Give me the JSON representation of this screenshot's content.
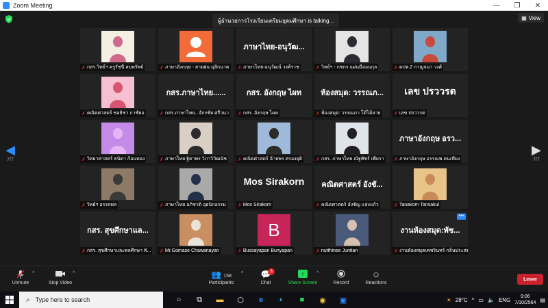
{
  "window": {
    "title": "Zoom Meeting",
    "controls": [
      "—",
      "❐",
      "✕"
    ]
  },
  "meeting": {
    "talking_text": "ผู้อำนวยการโรงเรียนเตรียมอุดมศึกษา is talking...",
    "view_label": "View",
    "page_indicator_left": "7/7",
    "page_indicator_right": "7/7"
  },
  "tiles": [
    {
      "label": "กสร.วิทย์ฯ ครูรัชนี สมทรัพย์",
      "kind": "photo",
      "photo_bg": "#f3efe3",
      "photo_fg": "#d06a8c"
    },
    {
      "label": "ภาษาอังกฤษ - สายฝน มุสิกนาค",
      "kind": "avatar",
      "photo_bg": "#f26b38",
      "photo_fg": "#ffffff"
    },
    {
      "label": "ภาษาไทย-อนุวัฒน์ วงศ์ราช",
      "kind": "name",
      "big": "ภาษาไทย-อนุวัฒ..."
    },
    {
      "label": "วิทย์ฯ - กชกร แผ่นมีอ่อนกุล",
      "kind": "photo",
      "photo_bg": "#e4e4e4",
      "photo_fg": "#2b2b33"
    },
    {
      "label": "ตปห.2 กาญจนา วงศ์",
      "kind": "photo",
      "photo_bg": "#7fa8c9",
      "photo_fg": "#c74b3a"
    },
    {
      "label": "คณิตศาสตร์ ชลธิชา กาชัยอ",
      "kind": "photo",
      "photo_bg": "#f7c0d0",
      "photo_fg": "#d6556f"
    },
    {
      "label": "กสร.ภาษาไทย...จักรชัย ศรีวนา",
      "kind": "name",
      "big": "กสร.ภาษาไทย......"
    },
    {
      "label": "กสร. อังกฤษ ไผท",
      "kind": "name",
      "big": "กสร. อังกฤษ ไผท"
    },
    {
      "label": "ห้องสมุด: วรรณภา โต้ไม้ลาย",
      "kind": "name",
      "big": "ห้องสมุด: วรรณภ..."
    },
    {
      "label": "เลข ปรววรต",
      "kind": "name",
      "big": "เลข ปรววรต"
    },
    {
      "label": "วิทยาศาสตร์ ธนิดา ก้อนทอง",
      "kind": "photo",
      "photo_bg": "#c58be8",
      "photo_fg": "#e6b5f5"
    },
    {
      "label": "ภาษาไทย ฐิตาพร วิภาวิวัฒนัช",
      "kind": "photo",
      "photo_bg": "#d9cfc4",
      "photo_fg": "#2b2b2b"
    },
    {
      "label": "คณิตศาสตร์ ฉ้ายพร ศรองยุติ",
      "kind": "photo",
      "photo_bg": "#9fb9d9",
      "photo_fg": "#2c2c2c"
    },
    {
      "label": "กสร. ภาษาไทย ณัฐพัชร์ เพียรา",
      "kind": "photo",
      "photo_bg": "#dfe4ea",
      "photo_fg": "#1f1f24"
    },
    {
      "label": "ภาษาอังกฤษ อรรณพ คนเทียง",
      "kind": "name",
      "big": "ภาษาอังกฤษ อรว..."
    },
    {
      "label": "วิทย์ฯ อรรถพล",
      "kind": "photo",
      "photo_bg": "#8d7a66",
      "photo_fg": "#3a3a3a"
    },
    {
      "label": "ภาษาไทย อภิชาติ อุยนิกอรรม",
      "kind": "photo",
      "photo_bg": "#a9a9a9",
      "photo_fg": "#22304a"
    },
    {
      "label": "Mos Sirakorn",
      "kind": "name",
      "big": "Mos Sirakorn"
    },
    {
      "label": "คณิตศาสตร์ อังชัญ แสงแก้ว",
      "kind": "name",
      "big": "คณิตศาสตร์ อังชั..."
    },
    {
      "label": "Tanakorn Tansakul",
      "kind": "photo",
      "photo_bg": "#e8c48a",
      "photo_fg": "#c98a5a"
    },
    {
      "label": "กสร. สุขศึกษาและพลศึกษา พิ...",
      "kind": "name",
      "big": "กสร. สุขศึกษาแล..."
    },
    {
      "label": "Mr.Gomase Chawanayan",
      "kind": "photo",
      "photo_bg": "#c98e62",
      "photo_fg": "#e9e3d8"
    },
    {
      "label": "Bussayapan Bunyapan",
      "kind": "letter",
      "big": "B",
      "photo_bg": "#c7245a",
      "photo_fg": "#ffffff"
    },
    {
      "label": "nutthinee Juntian",
      "kind": "photo",
      "photo_bg": "#4a5a7a",
      "photo_fg": "#d6c0b0"
    },
    {
      "label": "งานห้องสมุดเพชรินทร์ กลิ่นประสม",
      "kind": "name",
      "big": "งานห้องสมุด:พัช...",
      "more": "•••"
    }
  ],
  "toolbar": {
    "unmute": "Unmute",
    "stop_video": "Stop Video",
    "participants": "Participants",
    "participants_count": "158",
    "chat": "Chat",
    "chat_badge": "3",
    "share_screen": "Share Screen",
    "record": "Record",
    "reactions": "Reactions",
    "leave": "Leave"
  },
  "taskbar": {
    "search_placeholder": "Type here to search",
    "weather": "28°C",
    "lang": "ENG",
    "time": "9:06",
    "date": "7/10/2564"
  },
  "colors": {
    "accent": "#2d8cff",
    "share": "#23d959",
    "leave": "#c9222e",
    "mic_off": "#e02828"
  }
}
